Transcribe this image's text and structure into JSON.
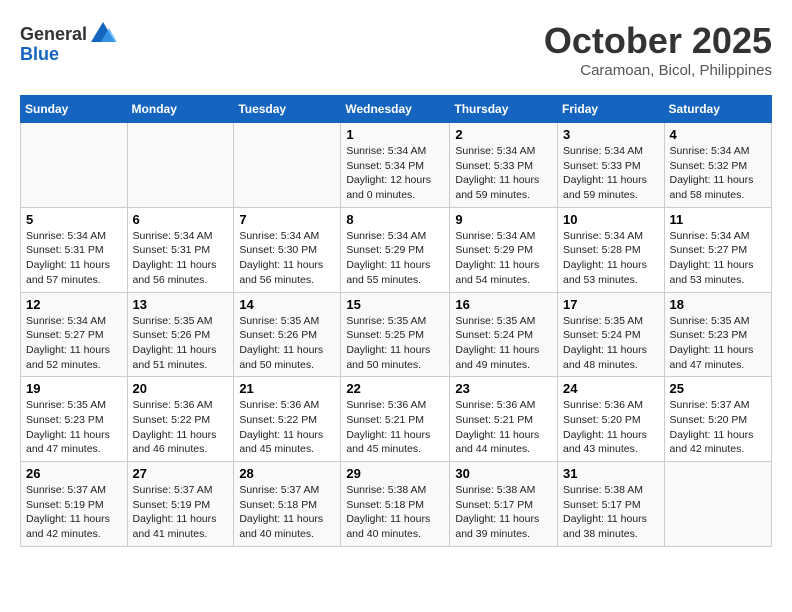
{
  "header": {
    "logo_general": "General",
    "logo_blue": "Blue",
    "month": "October 2025",
    "location": "Caramoan, Bicol, Philippines"
  },
  "weekdays": [
    "Sunday",
    "Monday",
    "Tuesday",
    "Wednesday",
    "Thursday",
    "Friday",
    "Saturday"
  ],
  "weeks": [
    [
      {
        "day": "",
        "sunrise": "",
        "sunset": "",
        "daylight": ""
      },
      {
        "day": "",
        "sunrise": "",
        "sunset": "",
        "daylight": ""
      },
      {
        "day": "",
        "sunrise": "",
        "sunset": "",
        "daylight": ""
      },
      {
        "day": "1",
        "sunrise": "Sunrise: 5:34 AM",
        "sunset": "Sunset: 5:34 PM",
        "daylight": "Daylight: 12 hours and 0 minutes."
      },
      {
        "day": "2",
        "sunrise": "Sunrise: 5:34 AM",
        "sunset": "Sunset: 5:33 PM",
        "daylight": "Daylight: 11 hours and 59 minutes."
      },
      {
        "day": "3",
        "sunrise": "Sunrise: 5:34 AM",
        "sunset": "Sunset: 5:33 PM",
        "daylight": "Daylight: 11 hours and 59 minutes."
      },
      {
        "day": "4",
        "sunrise": "Sunrise: 5:34 AM",
        "sunset": "Sunset: 5:32 PM",
        "daylight": "Daylight: 11 hours and 58 minutes."
      }
    ],
    [
      {
        "day": "5",
        "sunrise": "Sunrise: 5:34 AM",
        "sunset": "Sunset: 5:31 PM",
        "daylight": "Daylight: 11 hours and 57 minutes."
      },
      {
        "day": "6",
        "sunrise": "Sunrise: 5:34 AM",
        "sunset": "Sunset: 5:31 PM",
        "daylight": "Daylight: 11 hours and 56 minutes."
      },
      {
        "day": "7",
        "sunrise": "Sunrise: 5:34 AM",
        "sunset": "Sunset: 5:30 PM",
        "daylight": "Daylight: 11 hours and 56 minutes."
      },
      {
        "day": "8",
        "sunrise": "Sunrise: 5:34 AM",
        "sunset": "Sunset: 5:29 PM",
        "daylight": "Daylight: 11 hours and 55 minutes."
      },
      {
        "day": "9",
        "sunrise": "Sunrise: 5:34 AM",
        "sunset": "Sunset: 5:29 PM",
        "daylight": "Daylight: 11 hours and 54 minutes."
      },
      {
        "day": "10",
        "sunrise": "Sunrise: 5:34 AM",
        "sunset": "Sunset: 5:28 PM",
        "daylight": "Daylight: 11 hours and 53 minutes."
      },
      {
        "day": "11",
        "sunrise": "Sunrise: 5:34 AM",
        "sunset": "Sunset: 5:27 PM",
        "daylight": "Daylight: 11 hours and 53 minutes."
      }
    ],
    [
      {
        "day": "12",
        "sunrise": "Sunrise: 5:34 AM",
        "sunset": "Sunset: 5:27 PM",
        "daylight": "Daylight: 11 hours and 52 minutes."
      },
      {
        "day": "13",
        "sunrise": "Sunrise: 5:35 AM",
        "sunset": "Sunset: 5:26 PM",
        "daylight": "Daylight: 11 hours and 51 minutes."
      },
      {
        "day": "14",
        "sunrise": "Sunrise: 5:35 AM",
        "sunset": "Sunset: 5:26 PM",
        "daylight": "Daylight: 11 hours and 50 minutes."
      },
      {
        "day": "15",
        "sunrise": "Sunrise: 5:35 AM",
        "sunset": "Sunset: 5:25 PM",
        "daylight": "Daylight: 11 hours and 50 minutes."
      },
      {
        "day": "16",
        "sunrise": "Sunrise: 5:35 AM",
        "sunset": "Sunset: 5:24 PM",
        "daylight": "Daylight: 11 hours and 49 minutes."
      },
      {
        "day": "17",
        "sunrise": "Sunrise: 5:35 AM",
        "sunset": "Sunset: 5:24 PM",
        "daylight": "Daylight: 11 hours and 48 minutes."
      },
      {
        "day": "18",
        "sunrise": "Sunrise: 5:35 AM",
        "sunset": "Sunset: 5:23 PM",
        "daylight": "Daylight: 11 hours and 47 minutes."
      }
    ],
    [
      {
        "day": "19",
        "sunrise": "Sunrise: 5:35 AM",
        "sunset": "Sunset: 5:23 PM",
        "daylight": "Daylight: 11 hours and 47 minutes."
      },
      {
        "day": "20",
        "sunrise": "Sunrise: 5:36 AM",
        "sunset": "Sunset: 5:22 PM",
        "daylight": "Daylight: 11 hours and 46 minutes."
      },
      {
        "day": "21",
        "sunrise": "Sunrise: 5:36 AM",
        "sunset": "Sunset: 5:22 PM",
        "daylight": "Daylight: 11 hours and 45 minutes."
      },
      {
        "day": "22",
        "sunrise": "Sunrise: 5:36 AM",
        "sunset": "Sunset: 5:21 PM",
        "daylight": "Daylight: 11 hours and 45 minutes."
      },
      {
        "day": "23",
        "sunrise": "Sunrise: 5:36 AM",
        "sunset": "Sunset: 5:21 PM",
        "daylight": "Daylight: 11 hours and 44 minutes."
      },
      {
        "day": "24",
        "sunrise": "Sunrise: 5:36 AM",
        "sunset": "Sunset: 5:20 PM",
        "daylight": "Daylight: 11 hours and 43 minutes."
      },
      {
        "day": "25",
        "sunrise": "Sunrise: 5:37 AM",
        "sunset": "Sunset: 5:20 PM",
        "daylight": "Daylight: 11 hours and 42 minutes."
      }
    ],
    [
      {
        "day": "26",
        "sunrise": "Sunrise: 5:37 AM",
        "sunset": "Sunset: 5:19 PM",
        "daylight": "Daylight: 11 hours and 42 minutes."
      },
      {
        "day": "27",
        "sunrise": "Sunrise: 5:37 AM",
        "sunset": "Sunset: 5:19 PM",
        "daylight": "Daylight: 11 hours and 41 minutes."
      },
      {
        "day": "28",
        "sunrise": "Sunrise: 5:37 AM",
        "sunset": "Sunset: 5:18 PM",
        "daylight": "Daylight: 11 hours and 40 minutes."
      },
      {
        "day": "29",
        "sunrise": "Sunrise: 5:38 AM",
        "sunset": "Sunset: 5:18 PM",
        "daylight": "Daylight: 11 hours and 40 minutes."
      },
      {
        "day": "30",
        "sunrise": "Sunrise: 5:38 AM",
        "sunset": "Sunset: 5:17 PM",
        "daylight": "Daylight: 11 hours and 39 minutes."
      },
      {
        "day": "31",
        "sunrise": "Sunrise: 5:38 AM",
        "sunset": "Sunset: 5:17 PM",
        "daylight": "Daylight: 11 hours and 38 minutes."
      },
      {
        "day": "",
        "sunrise": "",
        "sunset": "",
        "daylight": ""
      }
    ]
  ]
}
